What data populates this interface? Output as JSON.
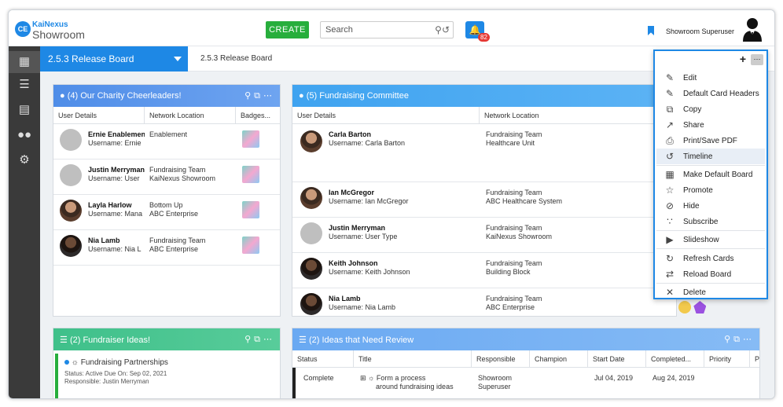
{
  "header": {
    "logo_mark": "CE",
    "brand_top": "KaiNexus",
    "brand_bottom": "Showroom",
    "create_label": "CREATE",
    "search_placeholder": "Search",
    "notification_count": "82",
    "user_name": "Showroom Superuser"
  },
  "board": {
    "selected": "2.5.3 Release Board",
    "crumb": "2.5.3 Release Board"
  },
  "cards": {
    "charity": {
      "title": "(4) Our Charity Cheerleaders!",
      "columns": [
        "User Details",
        "Network Location",
        "Badges..."
      ],
      "rows": [
        {
          "name": "Ernie Enablement",
          "username": "Username: Ernie",
          "loc1": "Enablement",
          "loc2": ""
        },
        {
          "name": "Justin Merryman",
          "username": "Username: User",
          "loc1": "Fundraising Team",
          "loc2": "KaiNexus Showroom"
        },
        {
          "name": "Layla Harlow",
          "username": "Username: Mana",
          "loc1": "Bottom Up",
          "loc2": "ABC Enterprise"
        },
        {
          "name": "Nia Lamb",
          "username": "Username: Nia L",
          "loc1": "Fundraising Team",
          "loc2": "ABC Enterprise"
        }
      ]
    },
    "committee": {
      "title": "(5) Fundraising Committee",
      "columns": [
        "User Details",
        "Network Location"
      ],
      "rows": [
        {
          "name": "Carla Barton",
          "username": "Username: Carla Barton",
          "loc1": "Fundraising Team",
          "loc2": "Healthcare Unit"
        },
        {
          "name": "Ian McGregor",
          "username": "Username: Ian McGregor",
          "loc1": "Fundraising Team",
          "loc2": "ABC Healthcare System"
        },
        {
          "name": "Justin Merryman",
          "username": "Username: User Type",
          "loc1": "Fundraising Team",
          "loc2": "KaiNexus Showroom"
        },
        {
          "name": "Keith Johnson",
          "username": "Username: Keith Johnson",
          "loc1": "Fundraising Team",
          "loc2": "Building Block"
        },
        {
          "name": "Nia Lamb",
          "username": "Username: Nia Lamb",
          "loc1": "Fundraising Team",
          "loc2": "ABC Enterprise"
        }
      ]
    },
    "ideas": {
      "title": "(2) Fundraiser Ideas!",
      "item_title": "Fundraising Partnerships",
      "item_meta": "Status: Active    Due On: Sep 02, 2021",
      "item_resp": "Responsible: Justin Merryman"
    },
    "review": {
      "title": "(2) Ideas that Need Review",
      "columns": [
        "Status",
        "Title",
        "Responsible",
        "Champion",
        "Start Date",
        "Completed...",
        "Priority",
        "P"
      ],
      "row": {
        "status": "Complete",
        "title1": "Form a process",
        "title2": "around fundraising ideas",
        "resp1": "Showroom",
        "resp2": "Superuser",
        "champion": "",
        "start": "Jul 04, 2019",
        "completed": "Aug 24, 2019",
        "priority": ""
      }
    }
  },
  "menu": {
    "items": [
      {
        "label": "Edit",
        "icon": "pencil-icon"
      },
      {
        "label": "Default Card Headers",
        "icon": "edit-box-icon"
      },
      {
        "label": "Copy",
        "icon": "copy-icon"
      },
      {
        "label": "Share",
        "icon": "share-icon"
      },
      {
        "label": "Print/Save PDF",
        "icon": "printer-icon"
      },
      {
        "label": "Timeline",
        "icon": "history-icon"
      },
      {
        "label": "Make Default Board",
        "icon": "grid-icon"
      },
      {
        "label": "Promote",
        "icon": "star-icon"
      },
      {
        "label": "Hide",
        "icon": "eye-off-icon"
      },
      {
        "label": "Subscribe",
        "icon": "rss-icon"
      },
      {
        "label": "Slideshow",
        "icon": "play-icon"
      },
      {
        "label": "Refresh Cards",
        "icon": "refresh-icon"
      },
      {
        "label": "Reload Board",
        "icon": "reload-icon"
      },
      {
        "label": "Delete",
        "icon": "close-icon"
      }
    ]
  },
  "colors": {
    "brand_blue": "#1e88e5",
    "create_green": "#27ae3c",
    "charity_head": "#4f8de8",
    "committee_head": "#3fa3f0",
    "ideas_head": "#3fc08a",
    "review_head": "#6aa9f2"
  }
}
